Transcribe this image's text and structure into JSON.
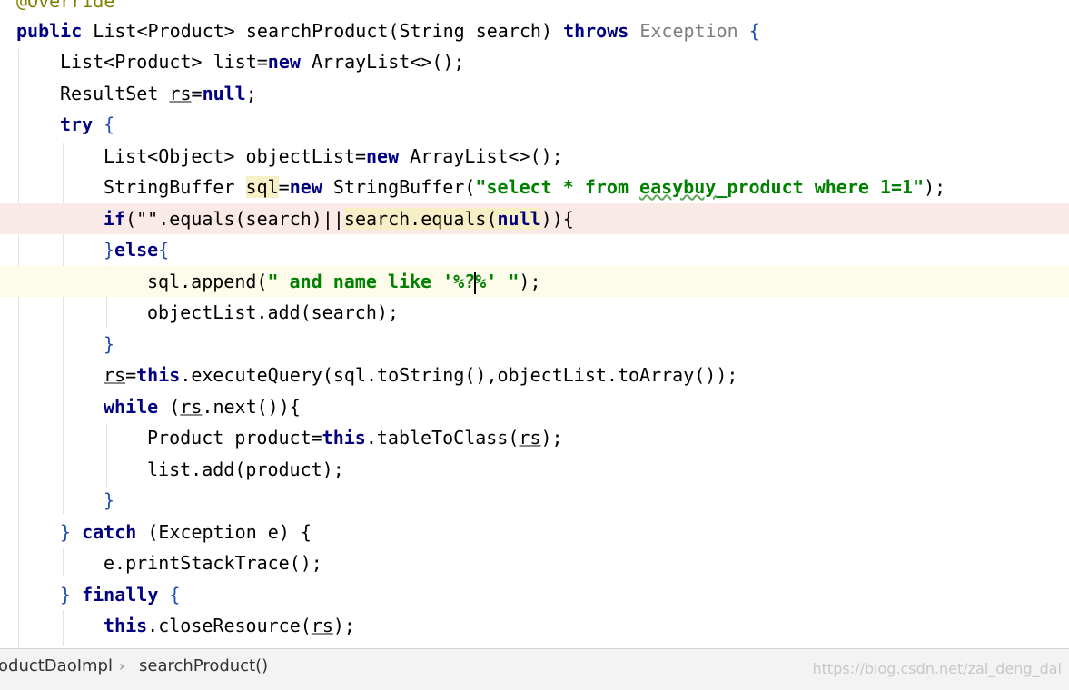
{
  "editor": {
    "lines": [
      {
        "id": "annotation",
        "text": "@Override"
      },
      {
        "id": "method-signature",
        "kw1": "public",
        "t1": " List<Product> searchProduct(String search) ",
        "kw2": "throws",
        "exc": " Exception",
        "br": " {"
      },
      {
        "id": "list-decl",
        "t1": "List<Product> list=",
        "kw": "new",
        "t2": " ArrayList<>();"
      },
      {
        "id": "resultset-decl",
        "t1": "ResultSet ",
        "var": "rs",
        "t2": "=",
        "kw": "null",
        "t3": ";"
      },
      {
        "id": "try",
        "kw": "try",
        "br": " {"
      },
      {
        "id": "objectlist-decl",
        "t1": "List<Object> objectList=",
        "kw": "new",
        "t2": " ArrayList<>();"
      },
      {
        "id": "stringbuffer-decl",
        "t1": "StringBuffer ",
        "var": "sql",
        "t2": "=",
        "kw": "new",
        "t3": " StringBuffer(",
        "s1": "\"select * from ",
        "s2": "easybuy",
        "s3": "_product where 1=1\"",
        "t4": ");"
      },
      {
        "id": "if-cond",
        "kw1": "if",
        "t1": "(\"\".equals(search)||",
        "t2": "search.equals(",
        "kw2": "null",
        "t3": ")){"
      },
      {
        "id": "else",
        "t1": "}",
        "kw": "else",
        "t2": "{"
      },
      {
        "id": "sql-append",
        "t1": "sql.append(",
        "s1": "\" and name like '%?",
        "s2": "%' \"",
        "t2": ");"
      },
      {
        "id": "objectlist-add",
        "t1": "objectList.add(search);"
      },
      {
        "id": "close-brace-1",
        "t1": "}"
      },
      {
        "id": "execute-query",
        "var": "rs",
        "t1": "=",
        "kw": "this",
        "t2": ".executeQuery(sql.toString(),objectList.toArray());"
      },
      {
        "id": "while",
        "kw": "while",
        "t1": " (",
        "var": "rs",
        "t2": ".next()){"
      },
      {
        "id": "product-decl",
        "t1": "Product product=",
        "kw": "this",
        "t2": ".tableToClass(",
        "var": "rs",
        "t3": ");"
      },
      {
        "id": "list-add",
        "t1": "list.add(product);"
      },
      {
        "id": "close-brace-2",
        "t1": "}"
      },
      {
        "id": "catch",
        "t1": "} ",
        "kw": "catch",
        "t2": " (Exception e) {"
      },
      {
        "id": "print-stack",
        "t1": "e.printStackTrace();"
      },
      {
        "id": "finally",
        "t1": "} ",
        "kw": "finally",
        "t2": " {"
      },
      {
        "id": "close-resource",
        "kw": "this",
        "t1": ".closeResource(",
        "var": "rs",
        "t2": ");"
      }
    ]
  },
  "statusbar": {
    "crumb_class": "oductDaoImpl",
    "crumb_sep": "›",
    "crumb_method": "searchProduct()",
    "watermark": "https://blog.csdn.net/zai_deng_dai"
  },
  "colors": {
    "keyword": "#000080",
    "string": "#008000",
    "annotation": "#808000",
    "exception": "#808080",
    "error_line": "#faeae7",
    "current_line": "#fdfbe9"
  }
}
